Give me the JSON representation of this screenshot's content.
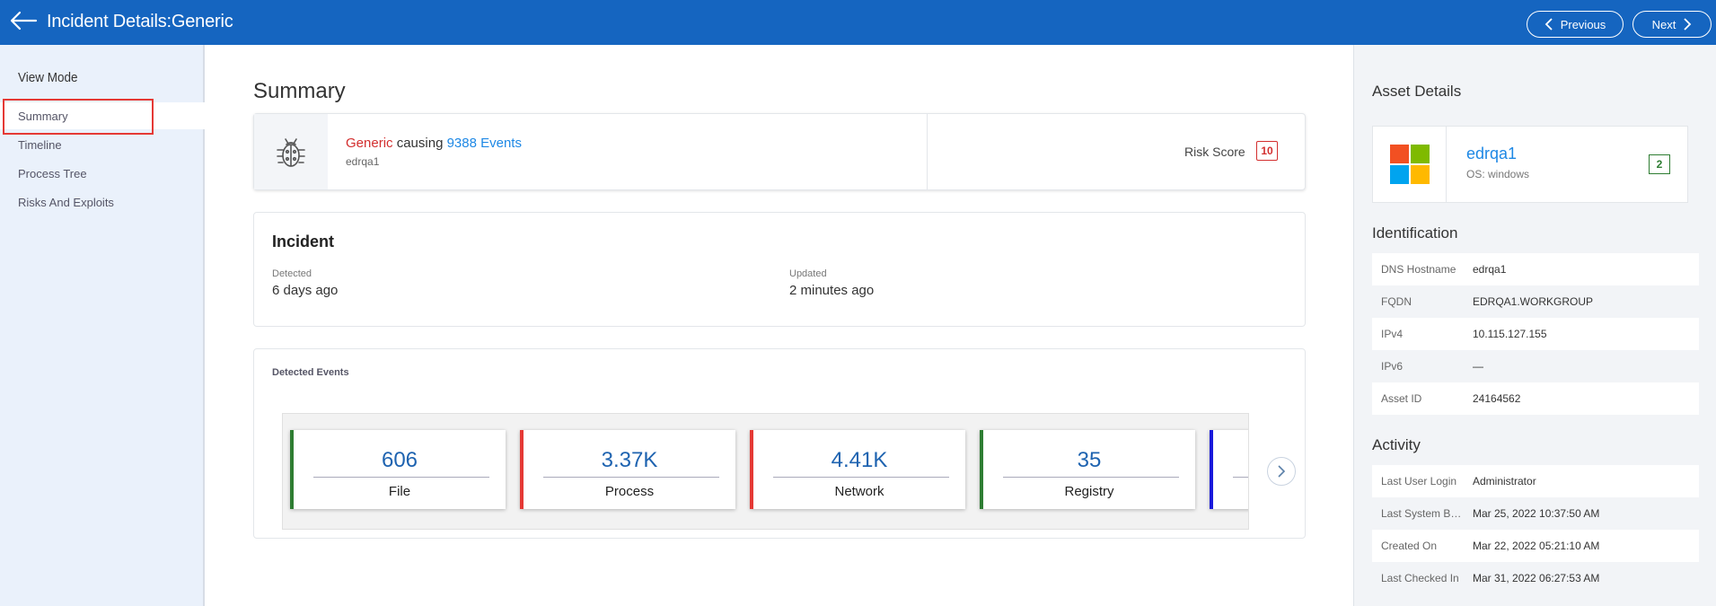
{
  "header": {
    "title": "Incident Details:Generic",
    "previous_label": "Previous",
    "next_label": "Next"
  },
  "sidebar": {
    "heading": "View Mode",
    "items": [
      {
        "label": "Summary",
        "active": true
      },
      {
        "label": "Timeline",
        "active": false
      },
      {
        "label": "Process Tree",
        "active": false
      },
      {
        "label": "Risks And Exploits",
        "active": false
      }
    ]
  },
  "summary": {
    "title": "Summary",
    "threat_name": "Generic",
    "causing_text": "causing",
    "events_text": "9388 Events",
    "hostname": "edrqa1",
    "risk_label": "Risk Score",
    "risk_score": "10"
  },
  "incident": {
    "title": "Incident",
    "detected_label": "Detected",
    "detected_value": "6 days ago",
    "updated_label": "Updated",
    "updated_value": "2 minutes ago"
  },
  "detected_events": {
    "title": "Detected Events",
    "tiles": [
      {
        "count": "606",
        "label": "File",
        "color": "#2e7d32"
      },
      {
        "count": "3.37K",
        "label": "Process",
        "color": "#e53935"
      },
      {
        "count": "4.41K",
        "label": "Network",
        "color": "#e53935"
      },
      {
        "count": "35",
        "label": "Registry",
        "color": "#2e7d32"
      },
      {
        "count": "",
        "label": "",
        "color": "#1a1adb"
      }
    ]
  },
  "asset_details": {
    "heading": "Asset Details",
    "name": "edrqa1",
    "os": "OS: windows",
    "badge": "2"
  },
  "identification": {
    "heading": "Identification",
    "rows": [
      {
        "key": "DNS Hostname",
        "value": "edrqa1"
      },
      {
        "key": "FQDN",
        "value": "EDRQA1.WORKGROUP"
      },
      {
        "key": "IPv4",
        "value": "10.115.127.155"
      },
      {
        "key": "IPv6",
        "value": "—"
      },
      {
        "key": "Asset ID",
        "value": "24164562"
      }
    ]
  },
  "activity": {
    "heading": "Activity",
    "rows": [
      {
        "key": "Last User Login",
        "value": "Administrator"
      },
      {
        "key": "Last System Bo...",
        "value": "Mar 25, 2022 10:37:50 AM"
      },
      {
        "key": "Created On",
        "value": "Mar 22, 2022 05:21:10 AM"
      },
      {
        "key": "Last Checked In",
        "value": "Mar 31, 2022 06:27:53 AM"
      }
    ]
  },
  "colors": {
    "header_bg": "#1565c0",
    "threat_red": "#d32f2f",
    "link_blue": "#1e88e5"
  }
}
